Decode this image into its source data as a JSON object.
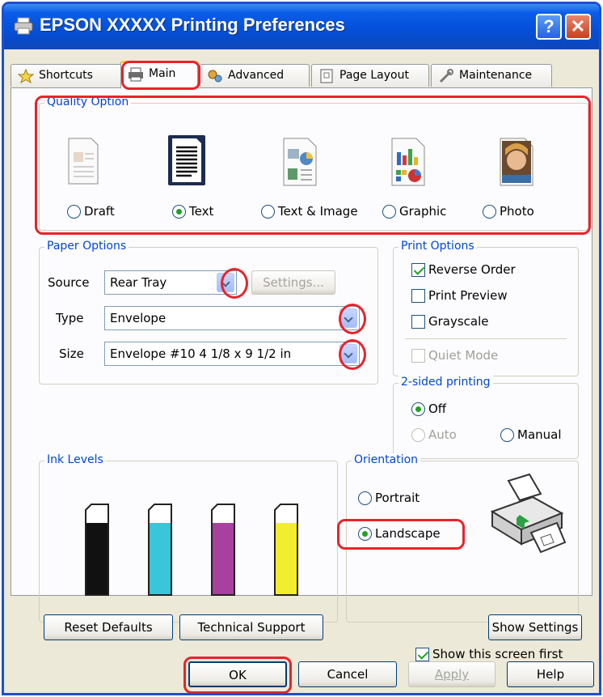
{
  "window": {
    "title": "EPSON XXXXX  Printing Preferences",
    "help_glyph": "?",
    "close_glyph": "✕"
  },
  "tabs": [
    {
      "label": "Shortcuts",
      "icon": "star-icon"
    },
    {
      "label": "Main",
      "icon": "printer-icon",
      "active": true
    },
    {
      "label": "Advanced",
      "icon": "gears-icon"
    },
    {
      "label": "Page Layout",
      "icon": "page-icon"
    },
    {
      "label": "Maintenance",
      "icon": "wrench-icon"
    }
  ],
  "quality": {
    "title": "Quality Option",
    "options": [
      {
        "label": "Draft",
        "selected": false
      },
      {
        "label": "Text",
        "selected": true
      },
      {
        "label": "Text & Image",
        "selected": false
      },
      {
        "label": "Graphic",
        "selected": false
      },
      {
        "label": "Photo",
        "selected": false
      }
    ]
  },
  "paper": {
    "title": "Paper Options",
    "source_label": "Source",
    "source_value": "Rear Tray",
    "settings_button": "Settings...",
    "type_label": "Type",
    "type_value": "Envelope",
    "size_label": "Size",
    "size_value": "Envelope #10 4 1/8 x 9 1/2 in"
  },
  "print_options": {
    "title": "Print Options",
    "items": [
      {
        "label": "Reverse Order",
        "checked": true,
        "enabled": true
      },
      {
        "label": "Print Preview",
        "checked": false,
        "enabled": true
      },
      {
        "label": "Grayscale",
        "checked": false,
        "enabled": true
      },
      {
        "label": "Quiet Mode",
        "checked": false,
        "enabled": false
      }
    ]
  },
  "two_sided": {
    "title": "2-sided printing",
    "off_label": "Off",
    "auto_label": "Auto",
    "manual_label": "Manual",
    "selected": "Off"
  },
  "ink": {
    "title": "Ink Levels",
    "cartridges": [
      {
        "color": "#111111"
      },
      {
        "color": "#38c6d8"
      },
      {
        "color": "#a8409f"
      },
      {
        "color": "#f2ee2e"
      }
    ]
  },
  "orientation": {
    "title": "Orientation",
    "portrait_label": "Portrait",
    "landscape_label": "Landscape",
    "selected": "Landscape"
  },
  "show_first": {
    "label": "Show this screen first",
    "checked": true
  },
  "buttons": {
    "reset": "Reset Defaults",
    "tech": "Technical Support",
    "show_settings": "Show Settings",
    "ok": "OK",
    "cancel": "Cancel",
    "apply": "Apply",
    "help": "Help"
  },
  "colors": {
    "titlebar": "#0450d9",
    "group_title": "#0046d5",
    "highlight": "#e8232a"
  }
}
